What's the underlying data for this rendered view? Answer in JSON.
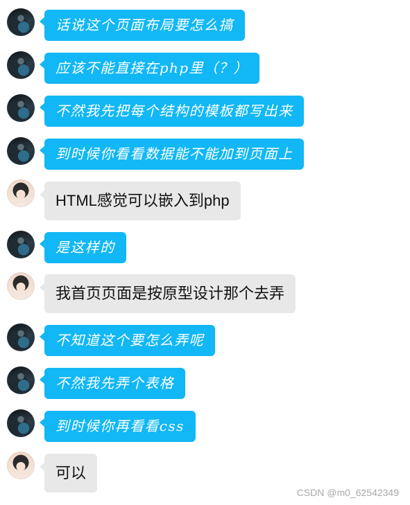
{
  "messages": [
    {
      "type": "blue",
      "text": "话说这个页面布局要怎么搞"
    },
    {
      "type": "blue",
      "text": "应该不能直接在php里（？）"
    },
    {
      "type": "blue",
      "text": "不然我先把每个结构的模板都写出来"
    },
    {
      "type": "blue",
      "text": "到时候你看看数据能不能加到页面上"
    },
    {
      "type": "gray",
      "text": "HTML感觉可以嵌入到php"
    },
    {
      "type": "blue",
      "text": "是这样的"
    },
    {
      "type": "gray",
      "text": "我首页页面是按原型设计那个去弄"
    },
    {
      "type": "blue",
      "text": "不知道这个要怎么弄呢"
    },
    {
      "type": "blue",
      "text": "不然我先弄个表格"
    },
    {
      "type": "blue",
      "text": "到时候你再看看css"
    },
    {
      "type": "gray",
      "text": "可以"
    }
  ],
  "watermark": "CSDN @m0_62542349",
  "colors": {
    "blue": "#12b7f5",
    "gray": "#e8e8e8"
  }
}
